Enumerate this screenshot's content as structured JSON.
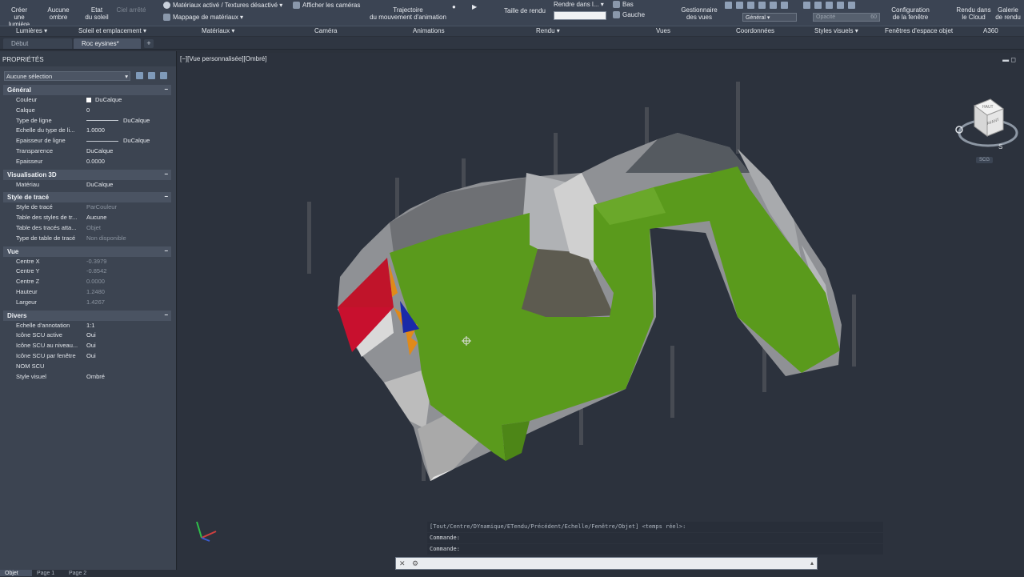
{
  "ribbon": {
    "lights_btn": "Créer\nune lumière",
    "shadow_btn": "Aucune\nombre",
    "sun_btn": "Etat\ndu soleil",
    "sky_btn": "Ciel arrêté",
    "materials_toggle": "Matériaux activé / Textures désactivé",
    "material_mapping": "Mappage de matériaux",
    "show_cameras": "Afficher les caméras",
    "anim_path": "Trajectoire\ndu mouvement d'animation",
    "render_size": "Taille de rendu",
    "render_in": "Rendre dans l...",
    "view_bottom": "Bas",
    "view_left": "Gauche",
    "view_manager": "Gestionnaire\ndes vues",
    "coord_general": "Général",
    "opacity_label": "Opacité",
    "opacity_value": "60",
    "viewport_config": "Configuration\nde la fenêtre",
    "render_cloud": "Rendu dans\nle Cloud",
    "render_gallery": "Galerie\nde rendu"
  },
  "panels": {
    "lights": "Lumières",
    "sun_location": "Soleil et emplacement",
    "materials": "Matériaux",
    "camera": "Caméra",
    "animations": "Animations",
    "render": "Rendu",
    "views": "Vues",
    "coordinates": "Coordonnées",
    "visual_styles": "Styles visuels",
    "viewports": "Fenêtres d'espace objet",
    "a360": "A360"
  },
  "tabs": {
    "start": "Début",
    "active": "Roc eysines*",
    "add": "+"
  },
  "properties": {
    "title": "PROPRIÉTÉS",
    "selection": "Aucune sélection",
    "sections": [
      {
        "name": "Général",
        "rows": [
          {
            "k": "Couleur",
            "v": "DuCalque"
          },
          {
            "k": "Calque",
            "v": "0"
          },
          {
            "k": "Type de ligne",
            "v": "DuCalque"
          },
          {
            "k": "Echelle du type de li...",
            "v": "1.0000"
          },
          {
            "k": "Epaisseur de ligne",
            "v": "DuCalque"
          },
          {
            "k": "Transparence",
            "v": "DuCalque"
          },
          {
            "k": "Epaisseur",
            "v": "0.0000"
          }
        ]
      },
      {
        "name": "Visualisation 3D",
        "rows": [
          {
            "k": "Matériau",
            "v": "DuCalque"
          }
        ]
      },
      {
        "name": "Style de tracé",
        "rows": [
          {
            "k": "Style de tracé",
            "v": "ParCouleur"
          },
          {
            "k": "Table des styles de tr...",
            "v": "Aucune"
          },
          {
            "k": "Table des tracés atta...",
            "v": "Objet"
          },
          {
            "k": "Type de table de tracé",
            "v": "Non disponible"
          }
        ]
      },
      {
        "name": "Vue",
        "rows": [
          {
            "k": "Centre X",
            "v": "-0.3979"
          },
          {
            "k": "Centre Y",
            "v": "-0.8542"
          },
          {
            "k": "Centre Z",
            "v": "0.0000"
          },
          {
            "k": "Hauteur",
            "v": "1.2480"
          },
          {
            "k": "Largeur",
            "v": "1.4267"
          }
        ]
      },
      {
        "name": "Divers",
        "rows": [
          {
            "k": "Echelle d'annotation",
            "v": "1:1"
          },
          {
            "k": "Icône SCU active",
            "v": "Oui"
          },
          {
            "k": "Icône SCU au niveau...",
            "v": "Oui"
          },
          {
            "k": "Icône SCU par fenêtre",
            "v": "Oui"
          },
          {
            "k": "NOM SCU",
            "v": ""
          },
          {
            "k": "Style visuel",
            "v": "Ombré"
          }
        ]
      }
    ]
  },
  "viewport": {
    "label": "[−][Vue personnalisée][Ombré]",
    "viewcube_top": "HAUT",
    "viewcube_front": "AVANT",
    "compass_s": "S",
    "wcs": "SCG"
  },
  "command": {
    "history_1": "[Tout/Centre/DYnamique/ETendu/Précédent/Echelle/Fenêtre/Objet] <temps réel>:",
    "history_2": "Commande:",
    "history_3": "Commande:",
    "input_placeholder": ""
  },
  "layouts": {
    "model": "Objet",
    "page1": "Page 1",
    "page2": "Page 2"
  },
  "colors": {
    "terrain_green": "#5a9a1c",
    "rock_grey": "#9a9a9a",
    "background": "#2c323d",
    "accent_red": "#c0142a",
    "accent_blue": "#1a2aa8",
    "accent_orange": "#e08a1a"
  }
}
